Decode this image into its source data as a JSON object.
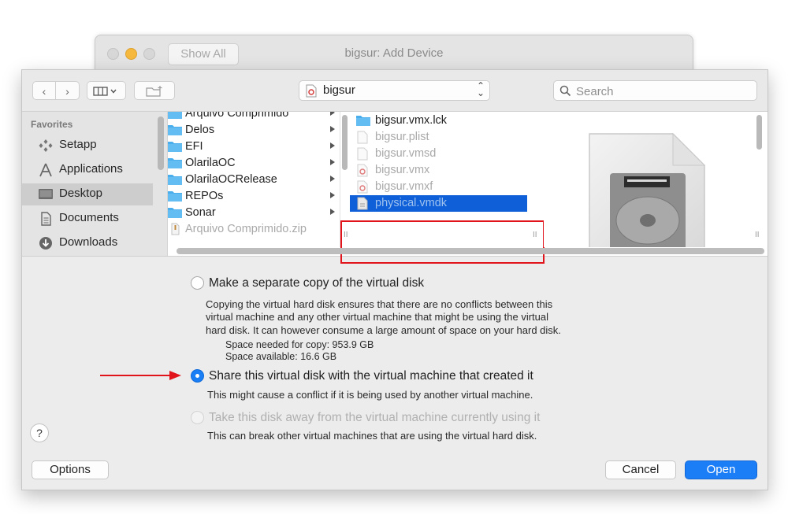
{
  "back_window": {
    "show_all_label": "Show All",
    "title": "bigsur: Add Device"
  },
  "toolbar": {
    "back_label": "‹",
    "forward_label": "›",
    "path_label": "bigsur",
    "search_placeholder": "Search"
  },
  "sidebar": {
    "heading": "Favorites",
    "items": [
      {
        "label": "Setapp",
        "icon": "setapp-icon"
      },
      {
        "label": "Applications",
        "icon": "applications-icon"
      },
      {
        "label": "Desktop",
        "icon": "desktop-icon",
        "active": true
      },
      {
        "label": "Documents",
        "icon": "documents-icon"
      },
      {
        "label": "Downloads",
        "icon": "downloads-icon"
      }
    ]
  },
  "column1": {
    "items": [
      {
        "label": "Arquivo Comprimido",
        "type": "folder"
      },
      {
        "label": "Delos",
        "type": "folder"
      },
      {
        "label": "EFI",
        "type": "folder"
      },
      {
        "label": "OlarilaOC",
        "type": "folder"
      },
      {
        "label": "OlarilaOCRelease",
        "type": "folder"
      },
      {
        "label": "REPOs",
        "type": "folder"
      },
      {
        "label": "Sonar",
        "type": "folder"
      },
      {
        "label": "Arquivo Comprimido.zip",
        "type": "zip"
      }
    ]
  },
  "column2": {
    "items": [
      {
        "label": "bigsur.vmx.lck",
        "type": "folder"
      },
      {
        "label": "bigsur.plist",
        "type": "file"
      },
      {
        "label": "bigsur.vmsd",
        "type": "file"
      },
      {
        "label": "bigsur.vmx",
        "type": "vmx"
      },
      {
        "label": "bigsur.vmxf",
        "type": "vmx"
      },
      {
        "label": "physical.vmdk",
        "type": "file",
        "selected": true
      }
    ]
  },
  "options": {
    "copy_label": "Make a separate copy of the virtual disk",
    "copy_desc_1": "Copying the virtual hard disk ensures that there are no conflicts between this",
    "copy_desc_2": "virtual machine and any other virtual machine that might be using the virtual",
    "copy_desc_3": "hard disk.  It can however consume a large amount of space on your hard disk.",
    "space_needed": "Space needed for copy: 953.9 GB",
    "space_available": "Space available: 16.6 GB",
    "share_label": "Share this virtual disk with the virtual machine that created it",
    "share_desc": "This might cause a conflict if it is being used by another virtual machine.",
    "take_label": "Take this disk away from the virtual machine currently using it",
    "take_desc": "This can break other virtual machines that are using the virtual hard disk."
  },
  "footer": {
    "help_label": "?",
    "options_label": "Options",
    "cancel_label": "Cancel",
    "open_label": "Open"
  },
  "colors": {
    "accent": "#1c7ef7",
    "selection": "#0e5fd8",
    "annotation_red": "#e1141c"
  }
}
